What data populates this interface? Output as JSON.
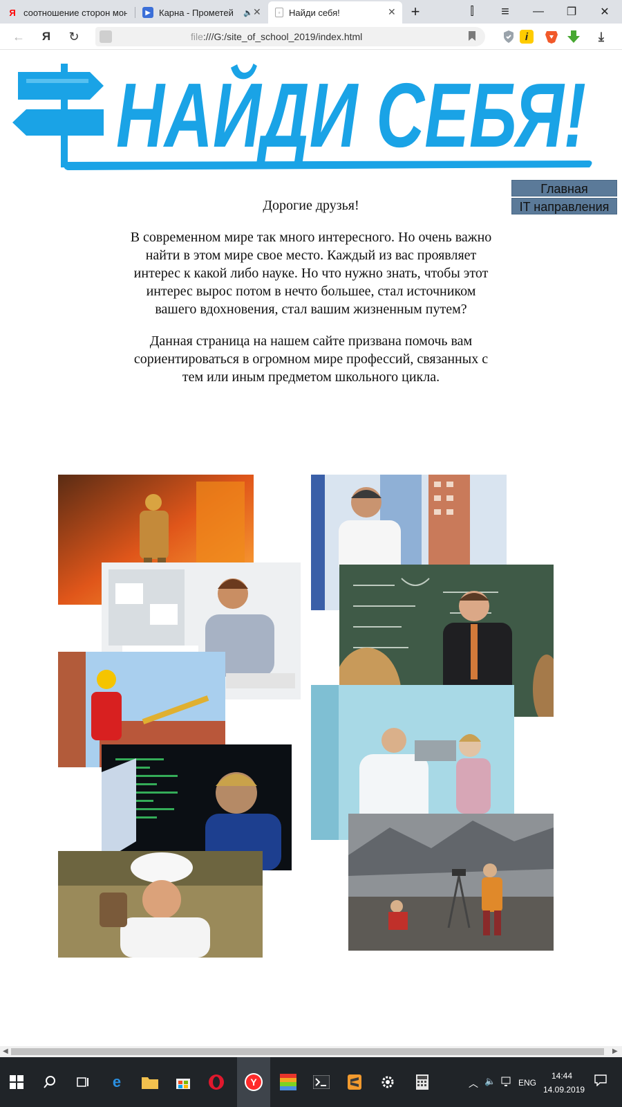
{
  "browser": {
    "tabs": [
      {
        "label": "соотношение сторон мон",
        "favicon": "yandex-icon",
        "favicon_glyph": "Я",
        "favicon_color": "#ff0000",
        "active": false
      },
      {
        "label": "Карна - Прометей",
        "favicon": "video-icon",
        "favicon_glyph": "▶",
        "favicon_color": "#3b6fd8",
        "active": false,
        "audio_glyph": "🔈"
      },
      {
        "label": "Найди себя!",
        "favicon": "page-icon",
        "favicon_glyph": "▫",
        "favicon_color": "#888888",
        "active": true
      }
    ],
    "new_tab_glyph": "+",
    "window_buttons": {
      "bookmarks_glyph": "⫿",
      "menu_glyph": "≡",
      "minimize_glyph": "—",
      "restore_glyph": "❐",
      "close_glyph": "✕"
    },
    "tab_close_glyph": "✕",
    "back_glyph": "←",
    "home_glyph": "Я",
    "reload_glyph": "↻",
    "url": {
      "scheme": "file",
      "rest": ":///G:/site_of_school_2019/index.html"
    },
    "download_glyph": "⤓"
  },
  "page": {
    "logo_text": "НАЙДИ СЕБЯ!",
    "logo_color": "#1aa3e6",
    "nav": [
      {
        "label": "Главная"
      },
      {
        "label": "IT направления"
      }
    ],
    "intro": {
      "greeting": "Дорогие друзья!",
      "paragraph1": "В современном мире так много интересного. Но очень важно найти в этом мире свое место. Каждый из вас проявляет интерес к какой либо науке. Но что нужно знать, чтобы этот интерес вырос потом в нечто большее, стал источником вашего вдохновения, стал вашим жизненным путем?",
      "paragraph2": "Данная страница на нашем сайте призвана помочь вам сориентироваться в огромном мире профессий, связанных с тем или иным предметом школьного цикла."
    },
    "photos": [
      {
        "name": "firefighter-photo",
        "subject": "firefighter"
      },
      {
        "name": "office-worker-photo",
        "subject": "office worker"
      },
      {
        "name": "builder-photo",
        "subject": "bricklayer"
      },
      {
        "name": "programmer-photo",
        "subject": "programmer"
      },
      {
        "name": "chef-photo",
        "subject": "chef"
      },
      {
        "name": "architect-photo",
        "subject": "architect"
      },
      {
        "name": "teacher-photo",
        "subject": "math teacher"
      },
      {
        "name": "doctor-photo",
        "subject": "ophthalmologist"
      },
      {
        "name": "geologist-photo",
        "subject": "geologist"
      }
    ]
  },
  "taskbar": {
    "language": "ENG",
    "time": "14:44",
    "date": "14.09.2019"
  }
}
